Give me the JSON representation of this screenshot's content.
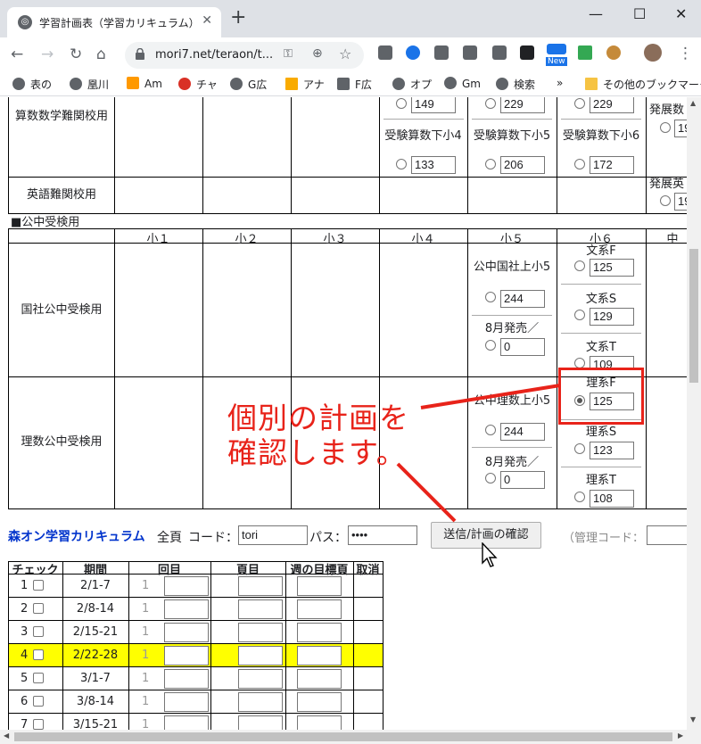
{
  "browser": {
    "tab_title": "学習計画表（学習カリキュラム）",
    "url": "mori7.net/teraon/t...",
    "bookmarks": [
      "表の",
      "凰川",
      "Am",
      "チャ",
      "G広",
      "アナ",
      "F広",
      "オプ",
      "Gm",
      "検索"
    ],
    "bookmarks_more": "»",
    "other_bookmarks": "その他のブックマーク",
    "ext_new_badge": "New",
    "colors": {
      "tabbar": "#dee1e6",
      "omnibox": "#f1f3f4"
    }
  },
  "curriculum": {
    "top_row_label": "算数数学難関校用",
    "top_cells": [
      {
        "label": "",
        "value": "149"
      },
      {
        "label": "",
        "value": "229"
      },
      {
        "label": "",
        "value": "229"
      },
      {
        "label": "受験算数下小4",
        "value": "133"
      },
      {
        "label": "受験算数下小5",
        "value": "206"
      },
      {
        "label": "受験算数下小6",
        "value": "172"
      }
    ],
    "edge_label_1": "発展数",
    "edge_value_1": "19",
    "english_row_label": "英語難関校用",
    "edge_label_2": "発展英",
    "edge_value_2": "19",
    "section_title": "■公中受検用",
    "columns": [
      "小１",
      "小２",
      "小３",
      "小４",
      "小５",
      "小６",
      "中"
    ],
    "kokusha_label": "国社公中受検用",
    "kokusha_cells": [
      {
        "label": "公中国社上小5",
        "value": "244"
      },
      {
        "label": "8月発売／",
        "value": "0"
      },
      {
        "label": "文系F",
        "value": "125"
      },
      {
        "label": "文系S",
        "value": "129"
      },
      {
        "label": "文系T",
        "value": "109"
      }
    ],
    "risu_label": "理数公中受検用",
    "risu_cells": [
      {
        "label": "公中理数上小5",
        "value": "244"
      },
      {
        "label": "8月発売／",
        "value": "0"
      },
      {
        "label": "理系F",
        "value": "125"
      },
      {
        "label": "理系S",
        "value": "123"
      },
      {
        "label": "理系T",
        "value": "108"
      }
    ]
  },
  "form": {
    "brand": "森オン学習カリキュラム",
    "zenpei": "全頁",
    "code_label": "コード：",
    "code_value": "tori",
    "pass_label": "パス：",
    "pass_value": "••••",
    "send_button": "送信/計画の確認",
    "admin_label": "（管理コード："
  },
  "schedule": {
    "headers": [
      "チェック",
      "期間",
      "回目",
      "頁目",
      "週の目標頁",
      "取消"
    ],
    "rows": [
      {
        "no": "1",
        "period": "2/1-7",
        "kai": "1"
      },
      {
        "no": "2",
        "period": "2/8-14",
        "kai": "1"
      },
      {
        "no": "3",
        "period": "2/15-21",
        "kai": "1"
      },
      {
        "no": "4",
        "period": "2/22-28",
        "kai": "1"
      },
      {
        "no": "5",
        "period": "3/1-7",
        "kai": "1"
      },
      {
        "no": "6",
        "period": "3/8-14",
        "kai": "1"
      },
      {
        "no": "7",
        "period": "3/15-21",
        "kai": "1"
      }
    ],
    "highlight_color": "#ffff00"
  },
  "annotation": {
    "line1": "個別の計画を",
    "line2": "確認します。",
    "color": "#e8231a"
  }
}
